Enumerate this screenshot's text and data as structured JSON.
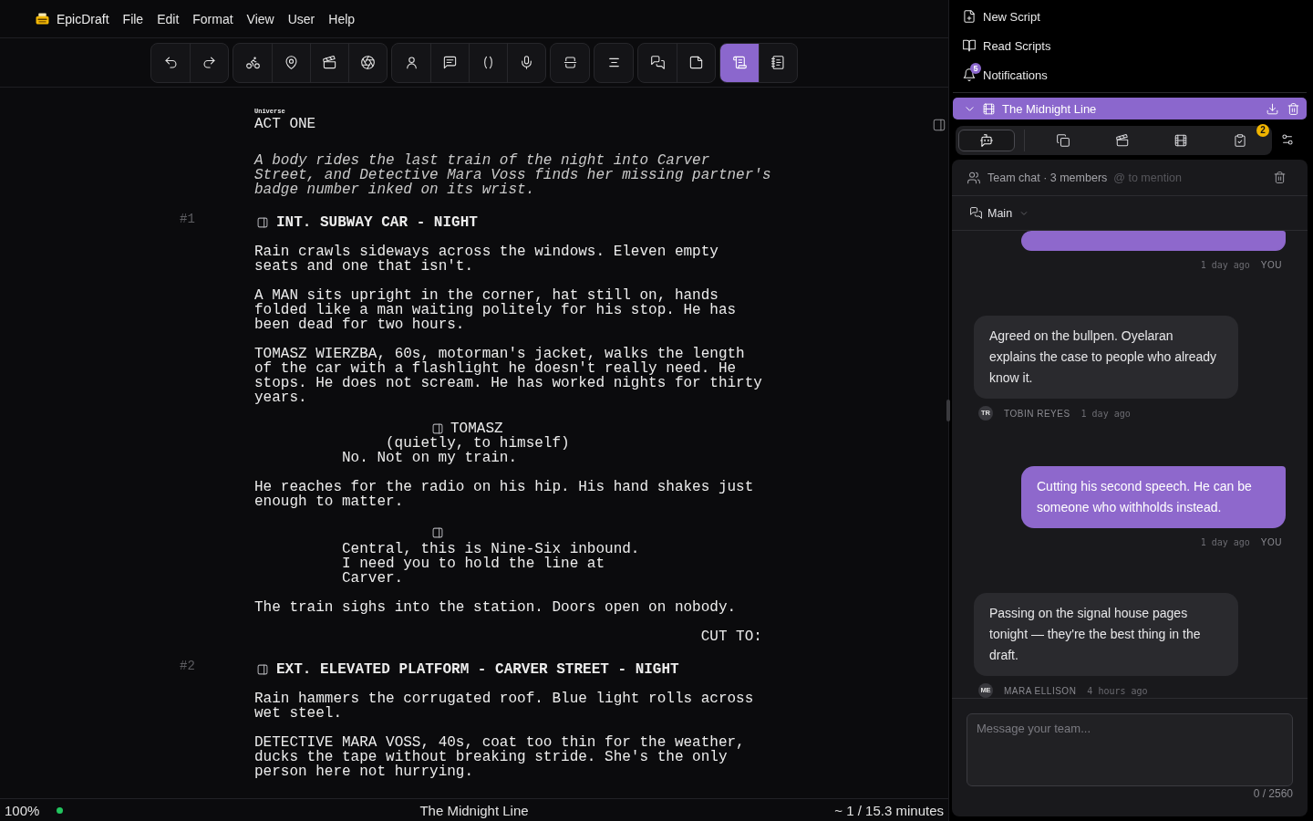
{
  "menu_bar": {
    "app_name": "EpicDraft",
    "menus": [
      "File",
      "Edit",
      "Format",
      "View",
      "User",
      "Help"
    ]
  },
  "toolbar": {
    "groups": [
      {
        "tools": [
          {
            "kind": "undo",
            "selected": false
          },
          {
            "kind": "redo",
            "selected": false
          }
        ]
      },
      {
        "tools": [
          {
            "kind": "bicycle",
            "selected": false
          },
          {
            "kind": "pin",
            "selected": false
          },
          {
            "kind": "clapperboard",
            "selected": false
          },
          {
            "kind": "aperture",
            "selected": false
          }
        ]
      },
      {
        "tools": [
          {
            "kind": "person",
            "selected": false
          },
          {
            "kind": "comment",
            "selected": false
          },
          {
            "kind": "parentheses",
            "selected": false
          },
          {
            "kind": "microphone",
            "selected": false
          }
        ]
      },
      {
        "tools": [
          {
            "kind": "split",
            "selected": false
          }
        ]
      },
      {
        "tools": [
          {
            "kind": "align",
            "selected": false
          }
        ]
      },
      {
        "tools": [
          {
            "kind": "chats",
            "selected": false
          },
          {
            "kind": "note",
            "selected": false
          }
        ]
      },
      {
        "tools": [
          {
            "kind": "scroll",
            "selected": true
          },
          {
            "kind": "notebook",
            "selected": false
          }
        ]
      }
    ]
  },
  "script": {
    "elements": [
      {
        "kind": "act",
        "label": "Universe",
        "text": "ACT ONE"
      },
      {
        "kind": "synopsis",
        "text": "A body rides the last train of the night into Carver Street, and Detective Mara Voss finds her missing partner's badge number inked on its wrist."
      },
      {
        "kind": "scene_heading",
        "number": "#1",
        "text": "INT. SUBWAY CAR - NIGHT"
      },
      {
        "kind": "action",
        "text": "Rain crawls sideways across the windows. Eleven empty seats and one that isn't."
      },
      {
        "kind": "action",
        "text": "A MAN sits upright in the corner, hat still on, hands folded like a man waiting politely for his stop. He has been dead for two hours."
      },
      {
        "kind": "action",
        "text": "TOMASZ WIERZBA, 60s, motorman's jacket, walks the length of the car with a flashlight he doesn't really need. He stops. He does not scream. He has worked nights for thirty years."
      },
      {
        "kind": "character",
        "text": "TOMASZ"
      },
      {
        "kind": "parenthetical",
        "text": "(quietly, to himself)"
      },
      {
        "kind": "dialogue",
        "text": "No. Not on my train."
      },
      {
        "kind": "action",
        "text": "He reaches for the radio on his hip. His hand shakes just enough to matter."
      },
      {
        "kind": "character"
      },
      {
        "kind": "dialogue",
        "text": "Central, this is Nine-Six inbound. I need you to hold the line at Carver."
      },
      {
        "kind": "action",
        "text": "The train sighs into the station. Doors open on nobody."
      },
      {
        "kind": "transition",
        "text": "CUT TO:"
      },
      {
        "kind": "scene_heading",
        "number": "#2",
        "text": "EXT. ELEVATED PLATFORM - CARVER STREET - NIGHT"
      },
      {
        "kind": "action",
        "text": "Rain hammers the corrugated roof. Blue light rolls across wet steel."
      },
      {
        "kind": "action",
        "text": "DETECTIVE MARA VOSS, 40s, coat too thin for the weather, ducks the tape without breaking stride. She's the only person here not hurrying."
      }
    ]
  },
  "status_bar": {
    "zoom": "100%",
    "online": true,
    "title": "The Midnight Line",
    "duration": "~ 1 / 15.3 minutes"
  },
  "side_menu": {
    "items": [
      {
        "kind": "new",
        "label": "New Script"
      },
      {
        "kind": "read",
        "label": "Read Scripts"
      },
      {
        "kind": "notifications",
        "label": "Notifications",
        "badge": "5"
      }
    ]
  },
  "project": {
    "title": "The Midnight Line",
    "expanded": true,
    "tabs": [
      {
        "kind": "chat",
        "selected": true
      },
      {
        "kind": "pages",
        "selected": false
      },
      {
        "kind": "scenes",
        "selected": false
      },
      {
        "kind": "film",
        "selected": false
      },
      {
        "kind": "tasks",
        "selected": false,
        "badge": "2"
      }
    ]
  },
  "chat": {
    "title": "Team chat · 3 members",
    "hint": "@ to mention",
    "channel": "Main",
    "messages": [
      {
        "own": true,
        "time": "1 day ago",
        "author": "YOU"
      },
      {
        "own": false,
        "text": "Agreed on the bullpen. Oyelaran explains the case to people who already know it.",
        "initials": "TR",
        "author": "TOBIN REYES",
        "time": "1 day ago"
      },
      {
        "own": true,
        "text": "Cutting his second speech. He can be someone who withholds instead.",
        "time": "1 day ago",
        "author": "YOU"
      },
      {
        "own": false,
        "text": "Passing on the signal house pages tonight — they're the best thing in the draft.",
        "initials": "ME",
        "author": "MARA ELLISON",
        "time": "4 hours ago"
      }
    ],
    "input": {
      "placeholder": "Message your team...",
      "counter": "0 / 2560"
    }
  }
}
